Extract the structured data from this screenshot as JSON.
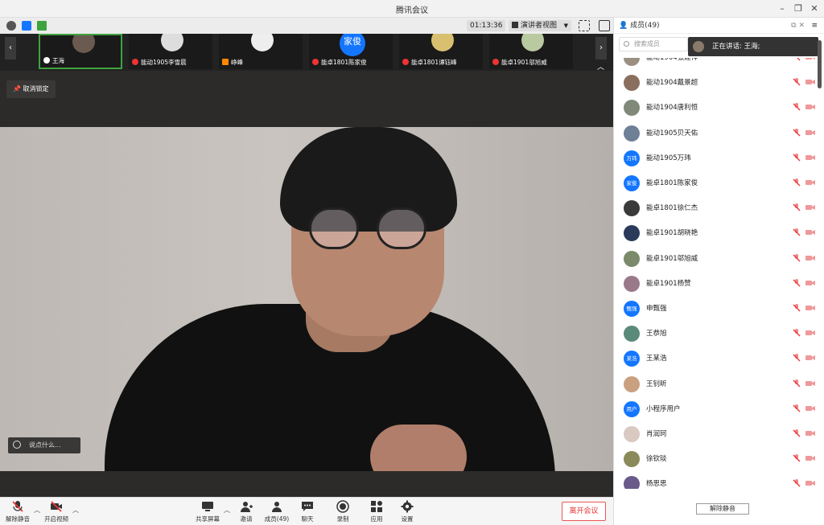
{
  "window": {
    "title": "腾讯会议"
  },
  "topbar": {
    "timer": "01:13:36",
    "view_label": "演讲者视图"
  },
  "thumbnails": [
    {
      "name": "王海",
      "mic": "on",
      "avatar_text": ""
    },
    {
      "name": "能动1905李雪晨",
      "mic": "off",
      "avatar_text": ""
    },
    {
      "name": "峥峰",
      "mic": "off",
      "avatar_text": ""
    },
    {
      "name": "能卓1801陈家俊",
      "mic": "off",
      "avatar_text": "家俊"
    },
    {
      "name": "能卓1801谭钰峰",
      "mic": "off",
      "avatar_text": ""
    },
    {
      "name": "能卓1901邬旭威",
      "mic": "off",
      "avatar_text": ""
    }
  ],
  "stage": {
    "unpin_label": "取消锁定",
    "chat_placeholder": "说点什么..."
  },
  "toolbar": {
    "unmute": "解除静音",
    "start_video": "开启视频",
    "share_screen": "共享屏幕",
    "invite": "邀请",
    "members": "成员(49)",
    "chat": "聊天",
    "record": "录制",
    "apps": "应用",
    "settings": "设置",
    "leave": "离开会议"
  },
  "panel": {
    "title": "成员(49)",
    "search_placeholder": "搜索成员",
    "speaking_label": "正在讲话: 王海;",
    "unmute_all": "解除静音",
    "participants": [
      {
        "name": "能动1904张建祥",
        "avatar_text": "",
        "avatar_color": "#9a8f80"
      },
      {
        "name": "能动1904戴景超",
        "avatar_text": "",
        "avatar_color": "#8a6f5e"
      },
      {
        "name": "能动1904唐利恒",
        "avatar_text": "",
        "avatar_color": "#7f8a7a"
      },
      {
        "name": "能动1905贝天佑",
        "avatar_text": "",
        "avatar_color": "#6e7f96"
      },
      {
        "name": "能动1905万玮",
        "avatar_text": "万玮",
        "avatar_color": "#1476ff"
      },
      {
        "name": "能卓1801陈家俊",
        "avatar_text": "家俊",
        "avatar_color": "#1476ff"
      },
      {
        "name": "能卓1801徐仁杰",
        "avatar_text": "",
        "avatar_color": "#3a3a3a"
      },
      {
        "name": "能卓1901胡晓艳",
        "avatar_text": "",
        "avatar_color": "#2a3a5a"
      },
      {
        "name": "能卓1901邬旭威",
        "avatar_text": "",
        "avatar_color": "#7a8a6a"
      },
      {
        "name": "能卓1901杨赞",
        "avatar_text": "",
        "avatar_color": "#9a7a8a"
      },
      {
        "name": "申甄强",
        "avatar_text": "甄强",
        "avatar_color": "#1476ff"
      },
      {
        "name": "王恭旭",
        "avatar_text": "",
        "avatar_color": "#5a8a7a"
      },
      {
        "name": "王某浩",
        "avatar_text": "某浩",
        "avatar_color": "#1476ff"
      },
      {
        "name": "王钊昕",
        "avatar_text": "",
        "avatar_color": "#c9a080"
      },
      {
        "name": "小程序用户",
        "avatar_text": "用户",
        "avatar_color": "#1476ff"
      },
      {
        "name": "肖润珂",
        "avatar_text": "",
        "avatar_color": "#d9c9c0"
      },
      {
        "name": "徐钦琰",
        "avatar_text": "",
        "avatar_color": "#8a8a5a"
      },
      {
        "name": "杨思思",
        "avatar_text": "",
        "avatar_color": "#6a5a8a"
      }
    ]
  },
  "colors": {
    "accent_blue": "#1476ff",
    "leave_red": "#e33333",
    "active_green": "#3ea33e"
  }
}
